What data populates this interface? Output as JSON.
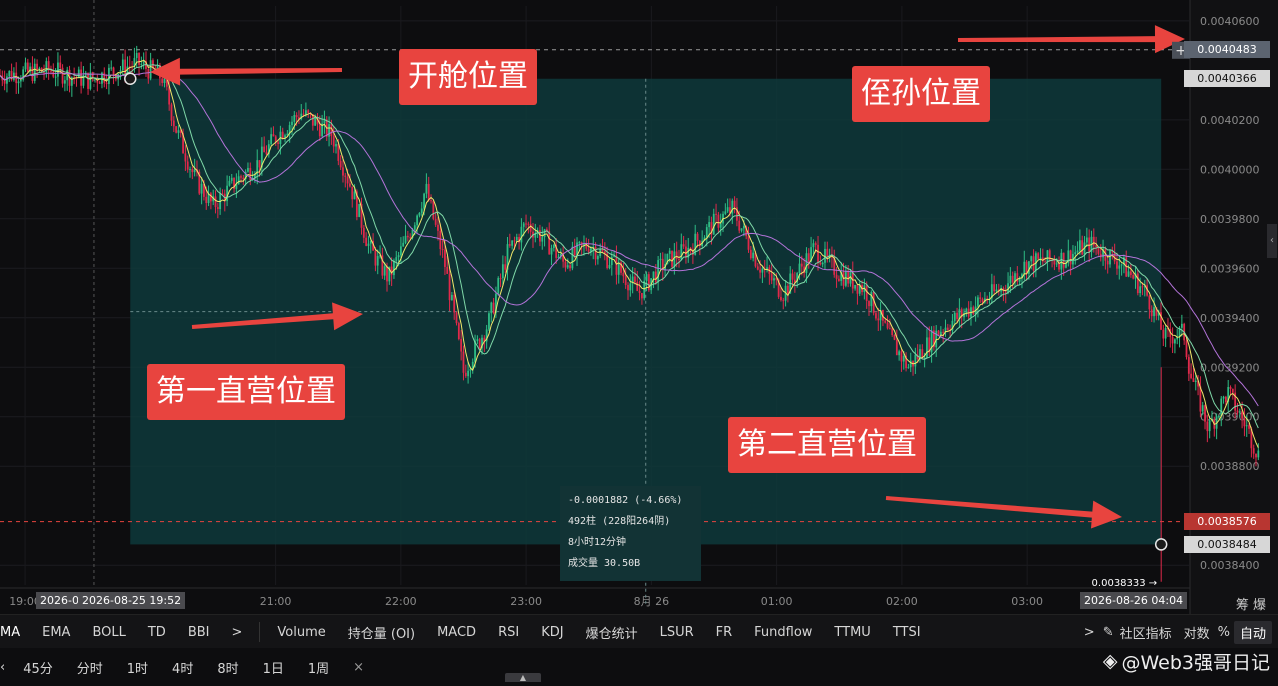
{
  "chart_data": {
    "type": "candlestick",
    "x_ticks": [
      "19:00",
      "21:00",
      "22:00",
      "23:00",
      "8月 26",
      "01:00",
      "02:00",
      "03:00"
    ],
    "y_ticks": [
      0.00406,
      0.00402,
      0.004,
      0.00398,
      0.00396,
      0.00394,
      0.00392,
      0.0039,
      0.00388,
      0.00384
    ],
    "y_tick_labels": [
      "0.0040600",
      "0.0040200",
      "0.0040000",
      "0.0039800",
      "0.0039600",
      "0.0039400",
      "0.0039200",
      "0.0039000",
      "0.0038800",
      "0.0038400"
    ],
    "ylim": [
      0.003832,
      0.004066
    ],
    "xlim_hours": [
      18.8,
      28.3
    ],
    "close_path": [
      [
        18.8,
        0.004038
      ],
      [
        19.2,
        0.00404
      ],
      [
        19.5,
        0.004036
      ],
      [
        19.9,
        0.004043
      ],
      [
        20.1,
        0.004037
      ],
      [
        20.2,
        0.004017
      ],
      [
        20.35,
        0.003997
      ],
      [
        20.5,
        0.003985
      ],
      [
        20.7,
        0.003996
      ],
      [
        20.85,
        0.004002
      ],
      [
        21.0,
        0.004013
      ],
      [
        21.2,
        0.004023
      ],
      [
        21.45,
        0.004014
      ],
      [
        21.6,
        0.003993
      ],
      [
        21.75,
        0.003968
      ],
      [
        21.9,
        0.003956
      ],
      [
        22.05,
        0.003972
      ],
      [
        22.2,
        0.003992
      ],
      [
        22.35,
        0.003962
      ],
      [
        22.5,
        0.003918
      ],
      [
        22.7,
        0.003938
      ],
      [
        22.85,
        0.003966
      ],
      [
        23.0,
        0.003978
      ],
      [
        23.15,
        0.003972
      ],
      [
        23.3,
        0.003962
      ],
      [
        23.5,
        0.00397
      ],
      [
        23.7,
        0.003962
      ],
      [
        23.9,
        0.00395
      ],
      [
        24.1,
        0.003962
      ],
      [
        24.3,
        0.003968
      ],
      [
        24.5,
        0.003978
      ],
      [
        24.65,
        0.003984
      ],
      [
        24.85,
        0.003962
      ],
      [
        25.05,
        0.00395
      ],
      [
        25.3,
        0.003968
      ],
      [
        25.5,
        0.003958
      ],
      [
        25.7,
        0.003952
      ],
      [
        25.9,
        0.003932
      ],
      [
        26.05,
        0.00392
      ],
      [
        26.3,
        0.003935
      ],
      [
        26.55,
        0.003944
      ],
      [
        26.8,
        0.003952
      ],
      [
        27.0,
        0.003962
      ],
      [
        27.3,
        0.003964
      ],
      [
        27.5,
        0.00397
      ],
      [
        27.75,
        0.003962
      ],
      [
        27.95,
        0.00395
      ],
      [
        28.1,
        0.003932
      ],
      [
        28.25,
        0.003934
      ],
      [
        28.3,
        0.003918
      ],
      [
        28.45,
        0.003895
      ],
      [
        28.6,
        0.00391
      ],
      [
        28.75,
        0.003896
      ],
      [
        28.85,
        0.003884
      ]
    ],
    "ma_series": [
      {
        "color": "#f2e86a"
      },
      {
        "color": "#7fd8a8"
      },
      {
        "color": "#b373d9"
      }
    ],
    "price_lines": [
      {
        "value": 0.0040483,
        "label": "0.0040483",
        "color": "#9a9a9a",
        "style": "dashed"
      },
      {
        "value": 0.0038576,
        "label": "0.0038576",
        "color": "#e8443f",
        "style": "dashed"
      }
    ],
    "price_tags": [
      {
        "value": 0.0040483,
        "label": "0.0040483",
        "bg": "#5c6470"
      },
      {
        "value": 0.0040366,
        "label": "0.0040366",
        "bg": "#d7d7d7",
        "fg": "#111111"
      },
      {
        "value": 0.0038576,
        "label": "0.0038576",
        "bg": "#b83631"
      },
      {
        "value": 0.0038484,
        "label": "0.0038484",
        "bg": "#d7d7d7",
        "fg": "#111111"
      }
    ],
    "measure": {
      "start": {
        "hour": 19.84,
        "price": 0.0040366
      },
      "end": {
        "hour": 28.07,
        "price": 0.0038484
      },
      "change": "-0.0001882 (-4.66%)",
      "bars": "492柱 (228阳264阴)",
      "duration": "8小时12分钟",
      "volume": "成交量 30.50B",
      "low_label": "0.0038333"
    },
    "crosshair": {
      "x_label": "2026-08-25 19:52",
      "end_x_label": "2026-08-26 04:04",
      "left_clip_label": "2026-0"
    },
    "annotations": [
      {
        "text": "开舱位置"
      },
      {
        "text": "侄孙位置"
      },
      {
        "text": "第一直营位置"
      },
      {
        "text": "第二直营位置"
      }
    ]
  },
  "toolbar": {
    "main_indicators": [
      "MA",
      "EMA",
      "BOLL",
      "TD",
      "BBI"
    ],
    "more": ">",
    "sub_indicators": [
      "Volume",
      "持仓量 (OI)",
      "MACD",
      "RSI",
      "KDJ",
      "爆仓统计",
      "LSUR",
      "FR",
      "Fundflow",
      "TTMU",
      "TTSI"
    ],
    "community": "社区指标",
    "log_label": "对数",
    "pct_label": "%",
    "auto_label": "自动"
  },
  "intervals": [
    "45分",
    "分时",
    "1时",
    "4时",
    "8时",
    "1日",
    "1周"
  ],
  "interval_close": "×",
  "footer_right": "筹 爆",
  "watermark": "@Web3强哥日记"
}
